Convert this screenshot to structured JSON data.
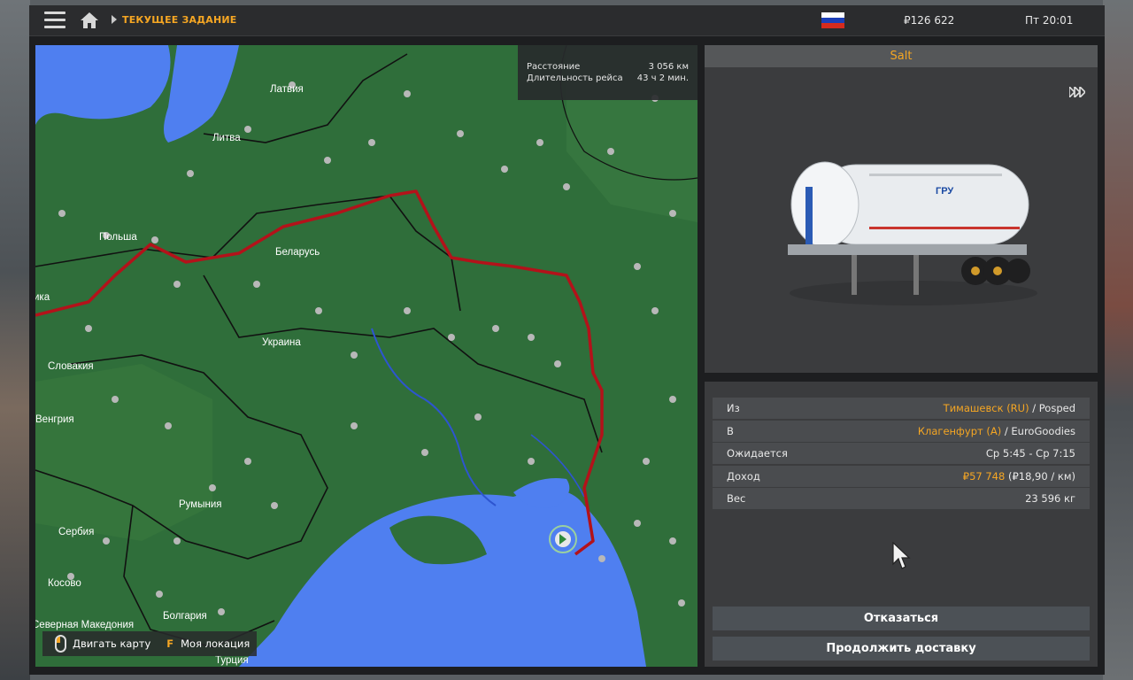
{
  "topbar": {
    "breadcrumb": "ТЕКУЩЕЕ ЗАДАНИЕ",
    "money": "₽126 622",
    "time": "Пт 20:01"
  },
  "map": {
    "distance_label": "Расстояние",
    "distance_value": "3 056 км",
    "duration_label": "Длительность рейса",
    "duration_value": "43 ч 2 мин.",
    "countries": [
      "Латвия",
      "Литва",
      "Польша",
      "Беларусь",
      "Украина",
      "Словакия",
      "Венгрия",
      "Румыния",
      "Сербия",
      "Косово",
      "Болгария",
      "Турция",
      "Северная Македония",
      "ика"
    ],
    "legend_move": "Двигать карту",
    "legend_key": "F",
    "legend_location": "Моя локация"
  },
  "cargo": {
    "name": "Salt",
    "trailer_text": "ГРУ"
  },
  "details": {
    "from_label": "Из",
    "from_city": "Тимашевск (RU)",
    "from_company": " / Posped",
    "to_label": "В",
    "to_city": "Клагенфурт (A)",
    "to_company": " / EuroGoodies",
    "expected_label": "Ожидается",
    "expected_value": "Ср 5:45 - Ср 7:15",
    "income_label": "Доход",
    "income_value": "₽57 748",
    "income_rate": " (₽18,90 / км)",
    "weight_label": "Вес",
    "weight_value": "23 596 кг"
  },
  "buttons": {
    "cancel": "Отказаться",
    "continue": "Продолжить доставку"
  },
  "colors": {
    "accent": "#f5a623",
    "route": "#b3121a",
    "land": "#2f6e3a",
    "water": "#4f7ff0"
  }
}
